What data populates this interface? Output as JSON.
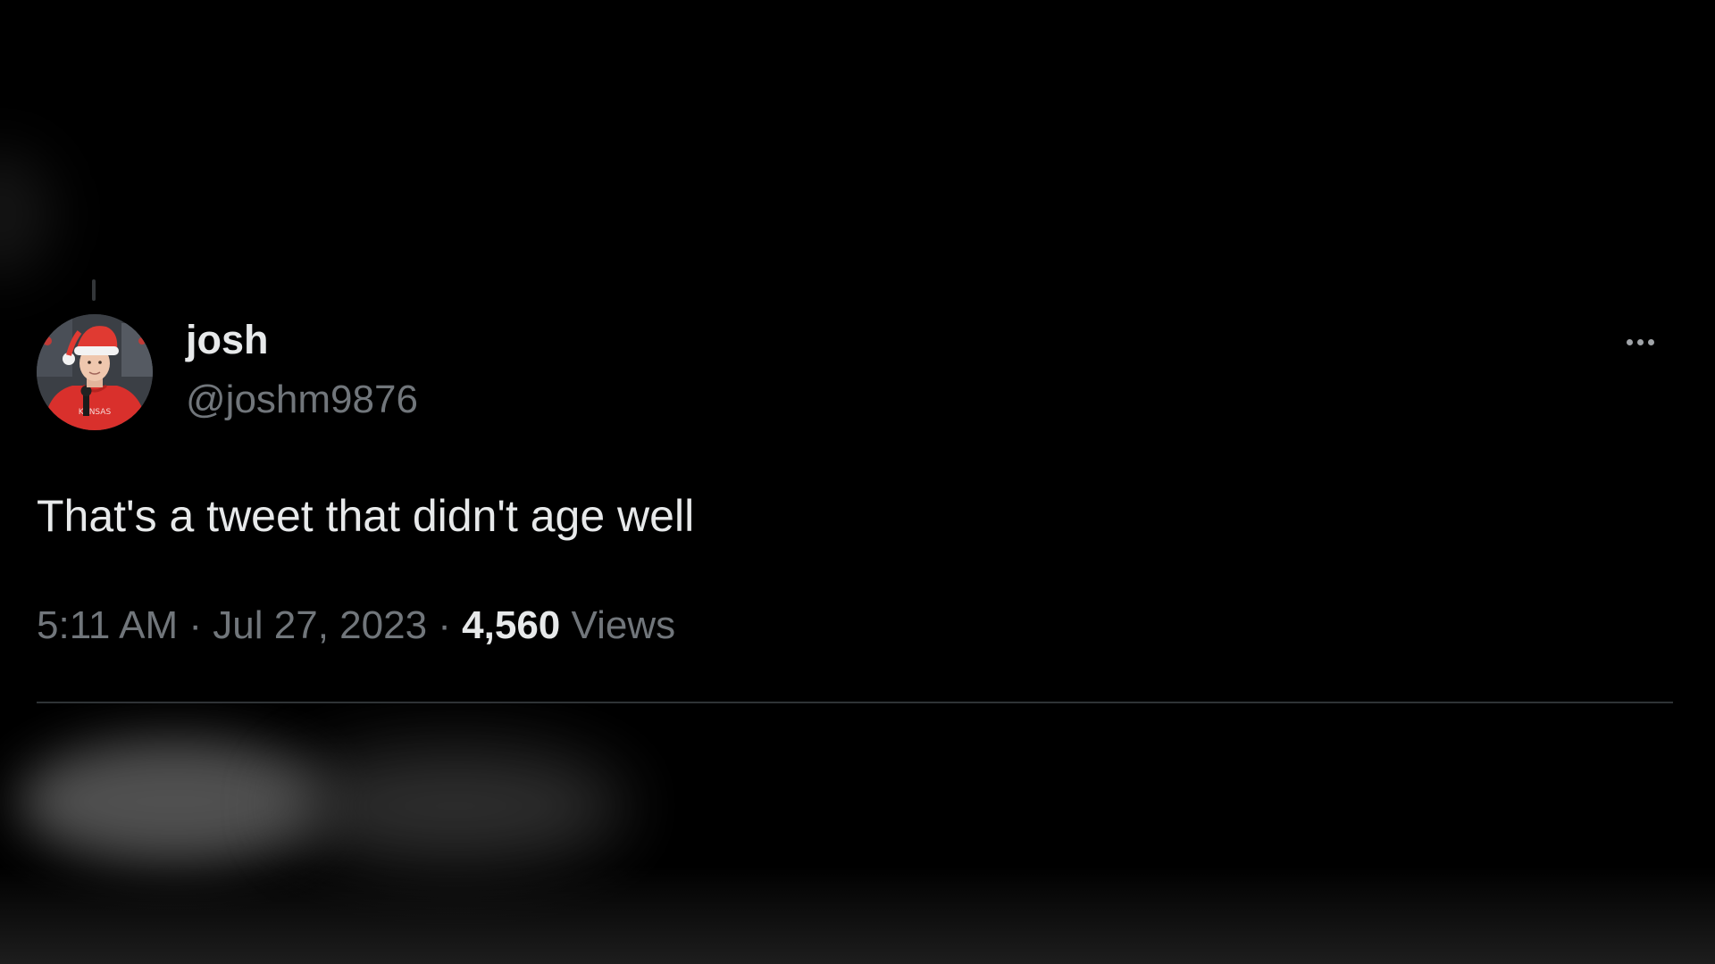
{
  "tweet": {
    "author_name": "josh",
    "author_handle": "@joshm9876",
    "text": "That's a tweet that didn't age well",
    "time": "5:11 AM",
    "separator": "·",
    "date": "Jul 27, 2023",
    "views_count": "4,560",
    "views_label": "Views",
    "avatar_icon": "avatar-santa-hat-icon",
    "more_icon": "more-options-icon"
  },
  "colors": {
    "background": "#000000",
    "primary_text": "#e7e9ea",
    "secondary_text": "#71767b",
    "divider": "#2f3336",
    "avatar_shirt": "#d9302c"
  }
}
